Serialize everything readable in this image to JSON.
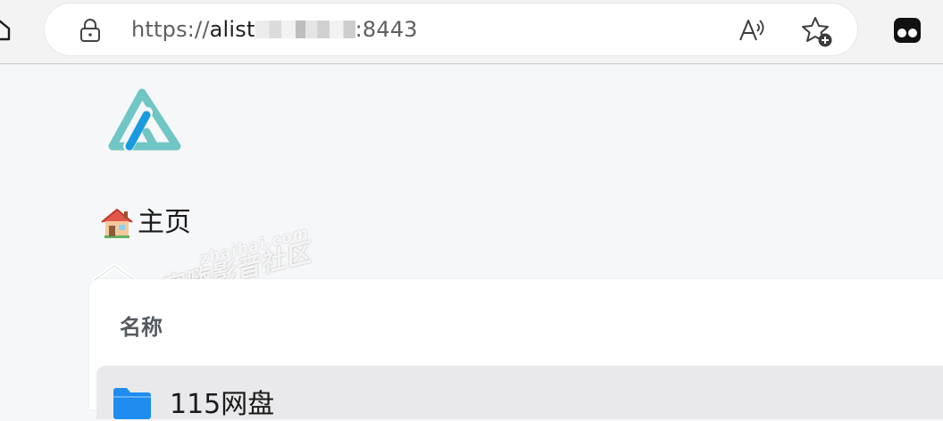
{
  "browser": {
    "url_scheme": "https://",
    "url_host_visible": "alist",
    "url_port": ":8443"
  },
  "icons": {
    "home": "home-icon",
    "lock": "lock-icon",
    "read_aloud": "read-aloud-icon",
    "favorite": "add-favorite-icon",
    "extension": "extension-icon",
    "logo": "alist-logo-icon",
    "breadcrumb_home": "house-emoji-icon",
    "folder": "folder-icon"
  },
  "breadcrumb": {
    "home_label": "主页"
  },
  "watermark": {
    "url": "zhaihai.com",
    "text": "宅嗨影音社区"
  },
  "file_list": {
    "column_name": "名称",
    "items": [
      {
        "name": "115网盘"
      }
    ]
  },
  "colors": {
    "page_background": "#f6f7f9",
    "logo_teal": "#70c6c4",
    "logo_blue": "#1a9be0",
    "folder_blue": "#1f8cf0",
    "row_hover": "#e9e9eb"
  }
}
